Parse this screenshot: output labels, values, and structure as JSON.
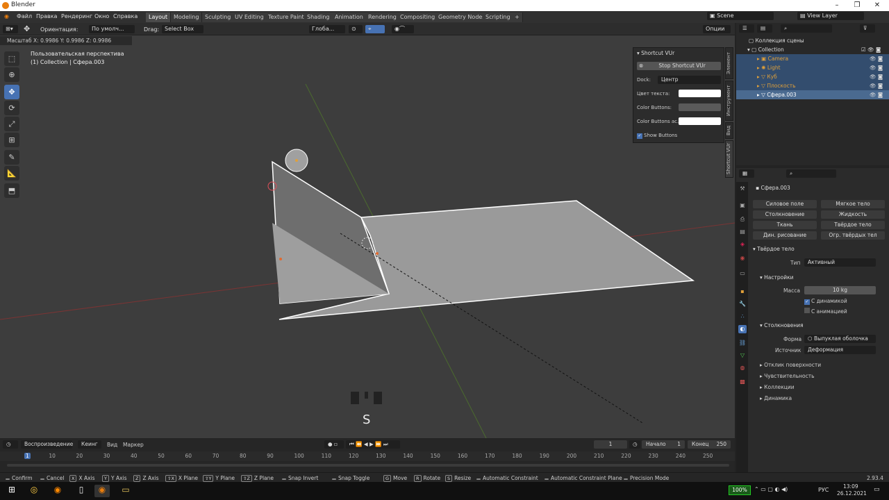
{
  "window": {
    "title": "Blender"
  },
  "menubar": {
    "menus": [
      "Файл",
      "Правка",
      "Рендеринг",
      "Окно",
      "Справка"
    ],
    "workspaces": [
      "Layout",
      "Modeling",
      "Sculpting",
      "UV Editing",
      "Texture Paint",
      "Shading",
      "Animation",
      "Rendering",
      "Compositing",
      "Geometry Nodes",
      "Scripting"
    ],
    "add_workspace": "+",
    "scene": "Scene",
    "view_layer": "View Layer"
  },
  "header3d": {
    "orientation_label": "Ориентация:",
    "orientation_value": "По умолч...",
    "drag_label": "Drag:",
    "drag_value": "Select Box",
    "global": "Глоба...",
    "options": "Опции"
  },
  "viewport": {
    "scale_info": "Масштаб X: 0.9986   Y: 0.9986   Z: 0.9986",
    "perspective": "Пользовательская перспектива",
    "collection_info": "(1) Collection | Сфера.003",
    "key_overlay": "S"
  },
  "npanel": {
    "title": "Shortcut VUr",
    "stop_button": "Stop Shortcut VUr",
    "dock_label": "Dock:",
    "dock_value": "Центр",
    "text_color_label": "Цвет текста:",
    "color_buttons_label": "Color Buttons:",
    "color_buttons_active_label": "Color Buttons ac...",
    "show_buttons_label": "Show Buttons",
    "tabs": [
      "Элемент",
      "Инструмент",
      "Вид",
      "Shortcut VUr"
    ]
  },
  "outliner": {
    "root": "Коллекция сцены",
    "collection": "Collection",
    "items": [
      "Camera",
      "Light",
      "Куб",
      "Плоскость",
      "Сфера.003"
    ]
  },
  "properties": {
    "object_name": "Сфера.003",
    "physics_buttons": [
      [
        "Силовое поле",
        "Мягкое тело"
      ],
      [
        "Столкновение",
        "Жидкость"
      ],
      [
        "Ткань",
        "Твёрдое тело"
      ],
      [
        "Дин. рисование",
        "Огр. твёрдых тел"
      ]
    ],
    "rigid_body_section": "Твёрдое тело",
    "type_label": "Тип",
    "type_value": "Активный",
    "settings_section": "Настройки",
    "mass_label": "Масса",
    "mass_value": "10 kg",
    "dynamic_label": "С динамикой",
    "animated_label": "С анимацией",
    "collisions_section": "Столкновения",
    "shape_label": "Форма",
    "shape_value": "Выпуклая оболочка",
    "source_label": "Источник",
    "source_value": "Деформация",
    "subsections": [
      "Отклик поверхности",
      "Чувствительность",
      "Коллекции",
      "Динамика"
    ]
  },
  "timeline": {
    "playback": "Воспроизведение",
    "keying": "Кеинг",
    "view": "Вид",
    "marker": "Маркер",
    "current_frame": "1",
    "start_label": "Начало",
    "start_value": "1",
    "end_label": "Конец",
    "end_value": "250",
    "ticks": [
      "1",
      "10",
      "20",
      "30",
      "40",
      "50",
      "60",
      "70",
      "80",
      "90",
      "100",
      "110",
      "120",
      "130",
      "140",
      "150",
      "160",
      "170",
      "180",
      "190",
      "200",
      "210",
      "220",
      "230",
      "240",
      "250"
    ]
  },
  "statusbar": {
    "items": [
      {
        "key": "",
        "label": "Confirm"
      },
      {
        "key": "",
        "label": "Cancel"
      },
      {
        "key": "X",
        "label": "X Axis"
      },
      {
        "key": "Y",
        "label": "Y Axis"
      },
      {
        "key": "Z",
        "label": "Z Axis"
      },
      {
        "key": "⇧X",
        "label": "X Plane"
      },
      {
        "key": "⇧Y",
        "label": "Y Plane"
      },
      {
        "key": "⇧Z",
        "label": "Z Plane"
      },
      {
        "key": "",
        "label": "Snap Invert"
      },
      {
        "key": "",
        "label": "Snap Toggle"
      },
      {
        "key": "G",
        "label": "Move"
      },
      {
        "key": "R",
        "label": "Rotate"
      },
      {
        "key": "S",
        "label": "Resize"
      },
      {
        "key": "",
        "label": "Automatic Constraint"
      },
      {
        "key": "",
        "label": "Automatic Constraint Plane"
      },
      {
        "key": "",
        "label": "Precision Mode"
      }
    ],
    "version": "2.93.4"
  },
  "taskbar": {
    "battery": "100%",
    "lang": "РУС",
    "time": "13:09",
    "date": "26.12.2021"
  },
  "colors": {
    "accent": "#4772b3",
    "selection": "#334d6e",
    "object_orange": "#e0a03a"
  }
}
